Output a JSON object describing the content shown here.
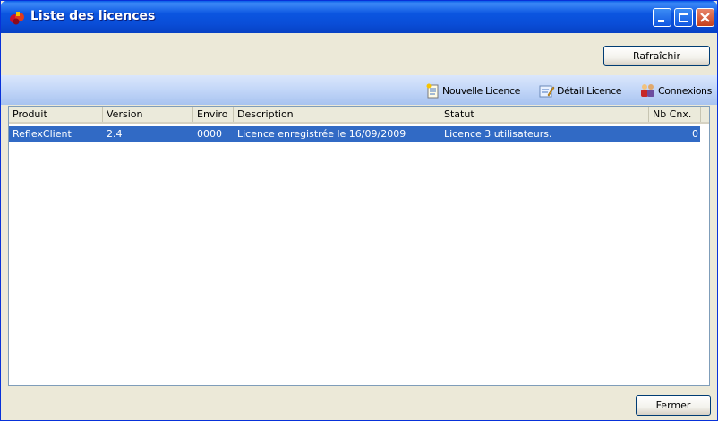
{
  "window": {
    "title": "Liste des licences",
    "accent": "#0a4ed8",
    "selection_color": "#316ac5"
  },
  "top": {
    "refresh_label": "Rafraîchir"
  },
  "toolbar": {
    "items": [
      {
        "label": "Nouvelle Licence",
        "icon": "new-document-icon"
      },
      {
        "label": "Détail Licence",
        "icon": "edit-document-icon"
      },
      {
        "label": "Connexions",
        "icon": "users-icon"
      }
    ]
  },
  "list": {
    "columns": [
      "Produit",
      "Version",
      "Enviro",
      "Description",
      "Statut",
      "Nb Cnx."
    ],
    "rows": [
      {
        "produit": "ReflexClient",
        "version": "2.4",
        "enviro": "0000",
        "description": "Licence enregistrée le 16/09/2009",
        "statut": "Licence 3 utilisateurs.",
        "nb_cnx": "0",
        "selected": true
      }
    ]
  },
  "footer": {
    "close_label": "Fermer"
  }
}
